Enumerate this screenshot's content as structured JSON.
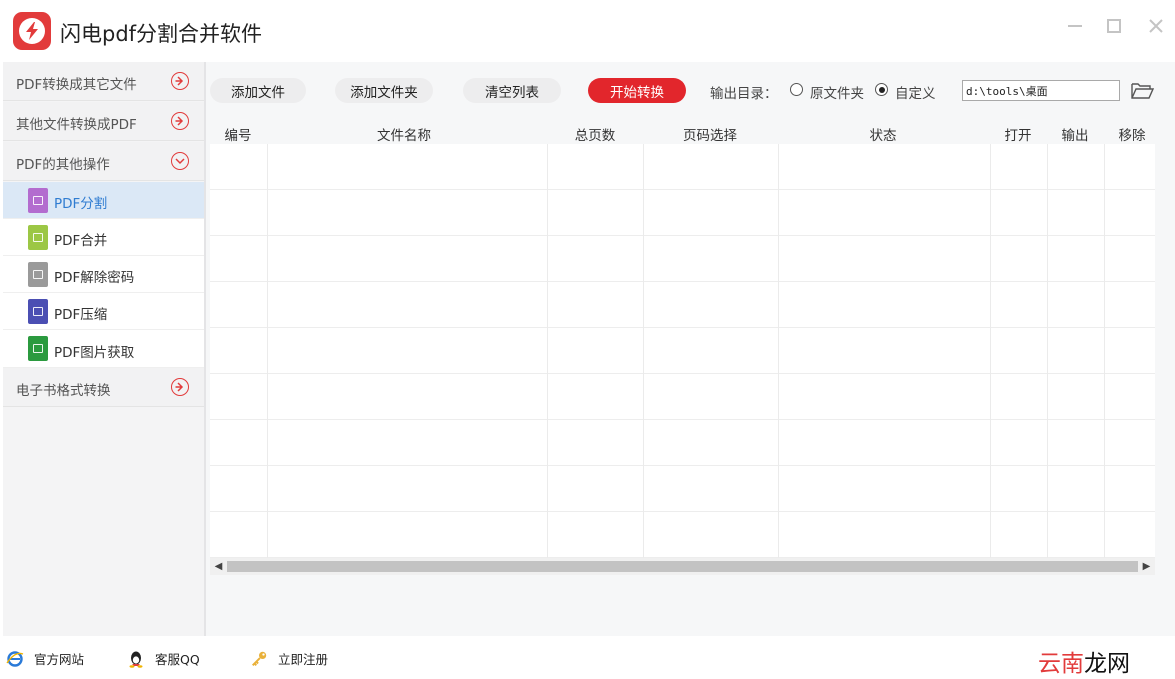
{
  "app": {
    "title": "闪电pdf分割合并软件"
  },
  "sidebar": {
    "categories": [
      {
        "label": "PDF转换成其它文件",
        "icon": "expand-arrow-icon"
      },
      {
        "label": "其他文件转换成PDF",
        "icon": "expand-arrow-icon"
      },
      {
        "label": "PDF的其他操作",
        "icon": "collapse-arrow-icon"
      },
      {
        "label": "电子书格式转换",
        "icon": "expand-arrow-icon"
      }
    ],
    "items": [
      {
        "label": "PDF分割",
        "icon": "split-icon",
        "color": "#b36ccf",
        "active": true
      },
      {
        "label": "PDF合并",
        "icon": "merge-icon",
        "color": "#9cc745"
      },
      {
        "label": "PDF解除密码",
        "icon": "unlock-icon",
        "color": "#9a9a9a"
      },
      {
        "label": "PDF压缩",
        "icon": "compress-icon",
        "color": "#4b4fb3"
      },
      {
        "label": "PDF图片获取",
        "icon": "image-icon",
        "color": "#2b9a3f"
      }
    ]
  },
  "toolbar": {
    "add_file": "添加文件",
    "add_folder": "添加文件夹",
    "clear_list": "清空列表",
    "start": "开始转换",
    "output_label": "输出目录：",
    "radio_original": "原文件夹",
    "radio_custom": "自定义",
    "selected_output": "custom",
    "output_path": "d:\\tools\\桌面"
  },
  "table": {
    "columns": [
      "编号",
      "文件名称",
      "总页数",
      "页码选择",
      "状态",
      "打开",
      "输出",
      "移除"
    ],
    "rows": []
  },
  "footer": {
    "website": "官方网站",
    "service": "客服QQ",
    "register": "立即注册"
  },
  "watermark": {
    "part1": "云南",
    "part2": "龙网"
  },
  "colors": {
    "accent": "#e2262c",
    "active_bg": "#dbe8f6",
    "active_text": "#2f7cd1"
  }
}
